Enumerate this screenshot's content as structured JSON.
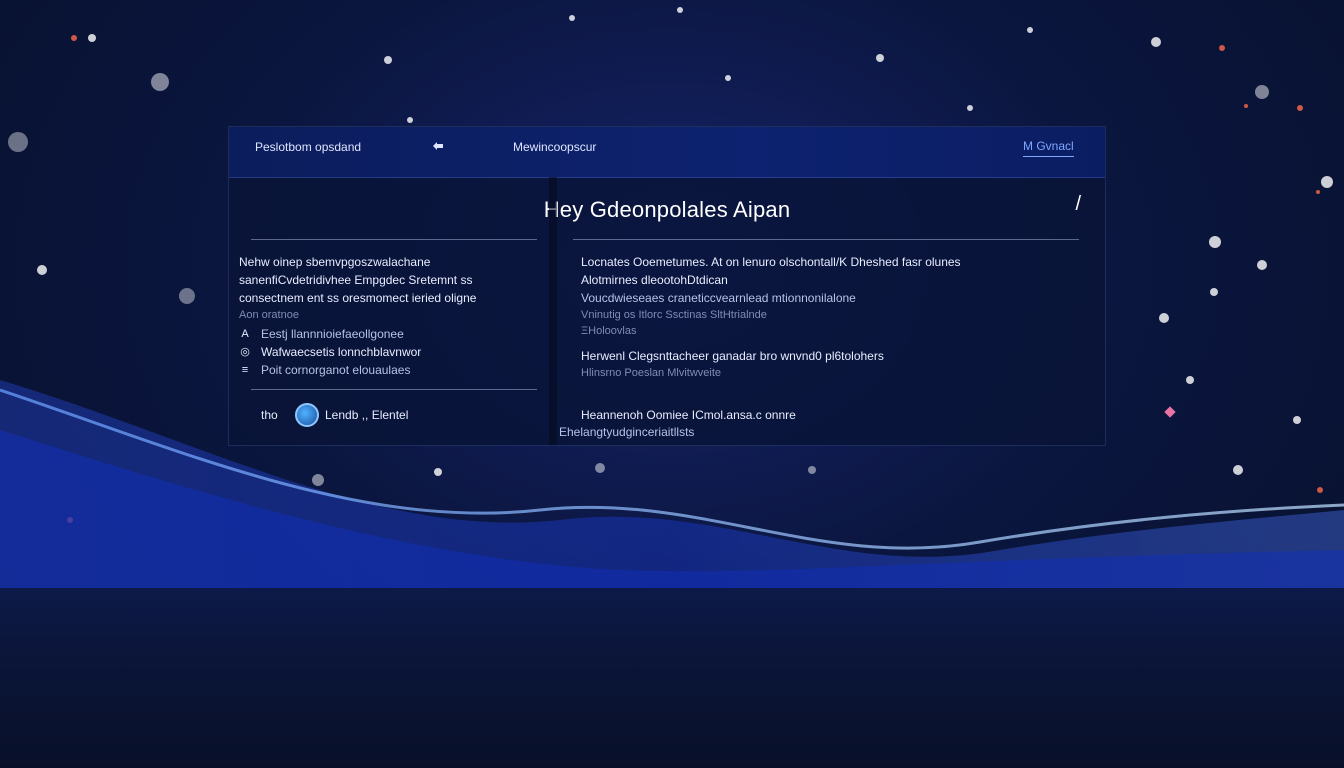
{
  "topbar": {
    "tab_left": "Peslotbom opsdand",
    "tab_icon": "link-icon",
    "tab_middle": "Mewincoopscur",
    "tab_right": "M Gvnacl"
  },
  "dialog": {
    "title": "Hey Gdeonpolales Aipan",
    "close_glyph": "/"
  },
  "left": {
    "lines": [
      "Nehw oinep sbemvpgoszwalachane",
      "sanenfiCvdetridivhee Empgdec Sretemnt ss",
      "consectnem ent ss oresmomect ieried oligne"
    ],
    "faint_line": "Aon oratnoe",
    "items": [
      {
        "bullet": "A",
        "text": "Eestj llannnioiefaeollgonee"
      },
      {
        "bullet": "◎",
        "text": "Wafwaecsetis lonnchblavnwor"
      },
      {
        "bullet": "≡",
        "text": "Poit cornorganot elouaulaes"
      }
    ],
    "footer_label": "tho",
    "footer_name": "Lendb ,, Elentel"
  },
  "right": {
    "group1": [
      "Locnates Ooemetumes. At on lenuro olschontall/K Dheshed fasr olunes",
      "Alotmirnes dleootohDtdican",
      "Voucdwieseaes craneticcvearnlead mtionnonilalone"
    ],
    "group1_faint": [
      "Vninutig os Itlorc Ssctinas SltHtrialnde",
      "ΞHoloovlas"
    ],
    "group2": "Herwenl Clegsnttacheer ganadar bro wnvnd0 pl6tolohers",
    "group2_faint": "Hlinsrno Poeslan Mlvitwveite",
    "group3": "Heannenoh Oomiee ICmol.ansa.c onnre",
    "group3_sub": "Ehelangtyudginceriaitllsts"
  },
  "colors": {
    "accent": "#7ea8ff",
    "panel": "#0a1538",
    "topbar": "#0d2270"
  }
}
